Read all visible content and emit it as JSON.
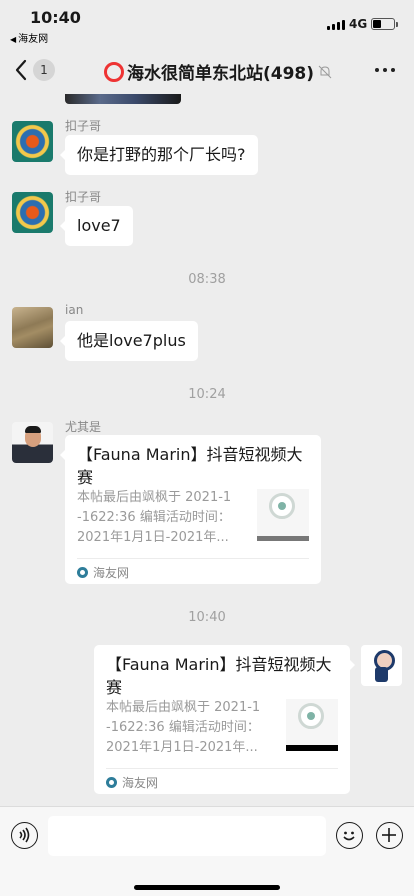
{
  "status_bar": {
    "time": "10:40",
    "back_app": "海友网",
    "network": "4G",
    "battery_level": 0.42
  },
  "nav": {
    "unread_badge": "1",
    "title": "海水很简单东北站(498)"
  },
  "messages": [
    {
      "sender": "扣子哥",
      "text": "你是打野的那个厂长吗?"
    },
    {
      "sender": "扣子哥",
      "text": "love7"
    },
    {
      "timestamp": "08:38"
    },
    {
      "sender": "ian",
      "text": "他是love7plus"
    },
    {
      "timestamp": "10:24"
    },
    {
      "sender": "尤其是",
      "card": {
        "title": "【Fauna Marin】抖音短视频大赛",
        "desc_lines": [
          "本帖最后由飒枫于 2021-1",
          "-1622:36 编辑活动时间：",
          "2021年1月1日-2021年..."
        ],
        "source": "海友网"
      }
    },
    {
      "timestamp": "10:40"
    },
    {
      "self": true,
      "card": {
        "title": "【Fauna Marin】抖音短视频大赛",
        "desc_lines": [
          "本帖最后由飒枫于 2021-1",
          "-1622:36 编辑活动时间：",
          "2021年1月1日-2021年..."
        ],
        "source": "海友网"
      }
    }
  ],
  "input": {
    "value": ""
  },
  "icons": {
    "back": "chevron-left-icon",
    "mute": "mute-bell-icon",
    "more": "more-dots-icon",
    "voice": "voice-icon",
    "emoji": "emoji-icon",
    "plus": "plus-icon"
  }
}
